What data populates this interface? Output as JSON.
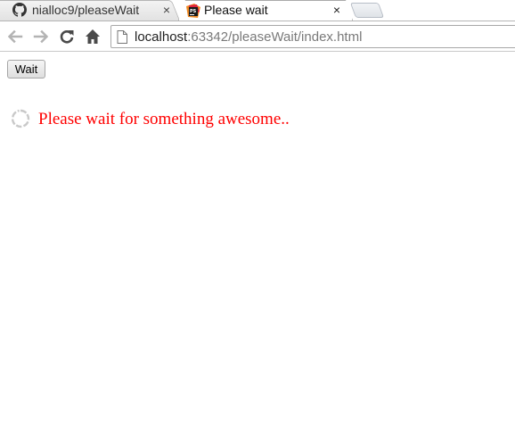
{
  "tabs": [
    {
      "title": "nialloc9/pleaseWait",
      "icon": "github-icon",
      "active": false
    },
    {
      "title": "Please wait",
      "icon": "webstorm-icon",
      "active": true
    }
  ],
  "tab_close_symbol": "×",
  "address_bar": {
    "host": "localhost",
    "path": ":63342/pleaseWait/index.html"
  },
  "page": {
    "button_label": "Wait",
    "message": "Please wait for something awesome..",
    "message_color": "#ff0000",
    "spinner_icon": "loading-spinner-icon"
  },
  "colors": {
    "nav_disabled": "#a9a9a9",
    "nav_enabled": "#4a4a4a"
  }
}
